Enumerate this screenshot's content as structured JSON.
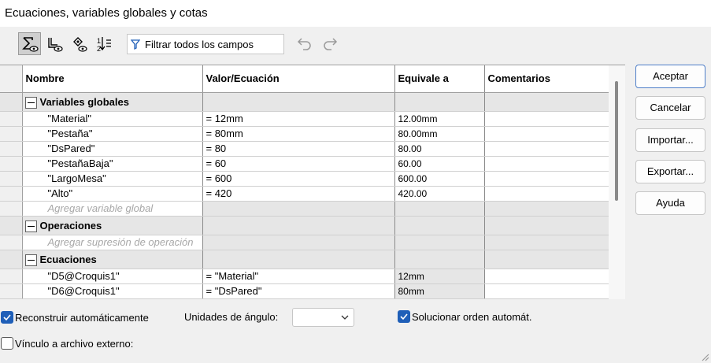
{
  "window": {
    "title": "Ecuaciones, variables globales y cotas"
  },
  "toolbar": {
    "buttons": [
      {
        "icon": "sum-view-icon",
        "active": true
      },
      {
        "icon": "dimension-view-icon",
        "active": false
      },
      {
        "icon": "ordered-view-icon",
        "active": false
      },
      {
        "icon": "sort-order-icon",
        "active": false
      }
    ],
    "filter_label": "Filtrar todos los campos",
    "undo_icon": "undo-icon",
    "redo_icon": "redo-icon"
  },
  "grid": {
    "columns": [
      "Nombre",
      "Valor/Ecuación",
      "Equivale a",
      "Comentarios"
    ],
    "groups": {
      "globals": {
        "label": "Variables globales",
        "rows": [
          {
            "name": "\"Material\"",
            "value": "= 12mm",
            "equals": "12.00mm",
            "comment": ""
          },
          {
            "name": "\"Pestaña\"",
            "value": "= 80mm",
            "equals": "80.00mm",
            "comment": ""
          },
          {
            "name": "\"DsPared\"",
            "value": "= 80",
            "equals": "80.00",
            "comment": ""
          },
          {
            "name": "\"PestañaBaja\"",
            "value": "= 60",
            "equals": "60.00",
            "comment": ""
          },
          {
            "name": "\"LargoMesa\"",
            "value": "= 600",
            "equals": "600.00",
            "comment": ""
          },
          {
            "name": "\"Alto\"",
            "value": "= 420",
            "equals": "420.00",
            "comment": ""
          }
        ],
        "add_placeholder": "Agregar variable global"
      },
      "operations": {
        "label": "Operaciones",
        "add_placeholder": "Agregar supresión de operación"
      },
      "equations": {
        "label": "Ecuaciones",
        "rows": [
          {
            "name": "\"D5@Croquis1\"",
            "value": "= \"Material\"",
            "equals": "12mm",
            "comment": ""
          },
          {
            "name": "\"D6@Croquis1\"",
            "value": "= \"DsPared\"",
            "equals": "80mm",
            "comment": ""
          }
        ]
      }
    }
  },
  "buttons": {
    "ok": "Aceptar",
    "cancel": "Cancelar",
    "import": "Importar...",
    "export": "Exportar...",
    "help": "Ayuda"
  },
  "options": {
    "auto_rebuild": {
      "label": "Reconstruir automáticamente",
      "checked": true
    },
    "angle_units_label": "Unidades de ángulo:",
    "angle_units_value": "",
    "auto_solve": {
      "label": "Solucionar orden automát.",
      "checked": true
    },
    "external_link": {
      "label": "Vínculo a archivo externo:",
      "checked": false
    }
  },
  "colors": {
    "accent": "#1f5fb8",
    "group_bg": "#e6e6e6",
    "primary_border": "#4f7fc8"
  }
}
